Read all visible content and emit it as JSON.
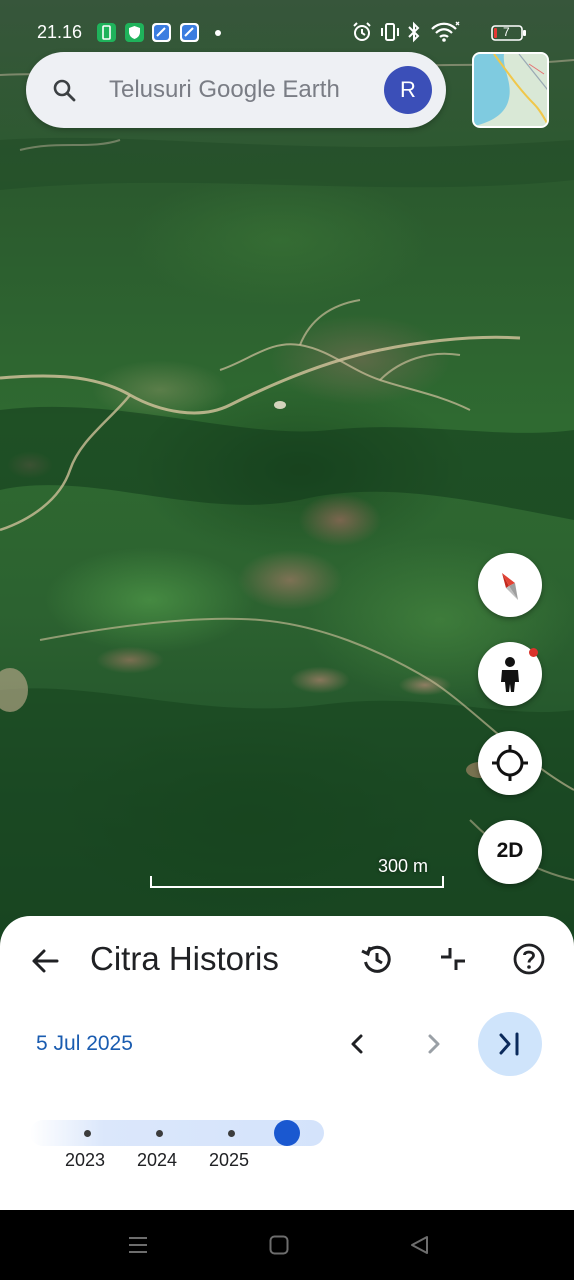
{
  "status_bar": {
    "time": "21.16",
    "icons": [
      "battery-saver-icon",
      "vpn-shield-icon",
      "app-icon",
      "app-icon",
      "alarm-icon",
      "vibrate-icon",
      "bluetooth-icon",
      "wifi-icon"
    ],
    "battery_level": "7"
  },
  "search": {
    "placeholder": "Telusuri Google Earth",
    "avatar_letter": "R"
  },
  "map": {
    "scale_label": "300 m"
  },
  "controls": {
    "view_mode_label": "2D"
  },
  "historical_imagery": {
    "title": "Citra Historis",
    "date": "5 Jul 2025",
    "years": [
      "2023",
      "2024",
      "2025"
    ]
  },
  "colors": {
    "accent_blue": "#1a5cb0",
    "avatar": "#3b4fb8",
    "knob": "#1a58d0",
    "last_button_bg": "#cfe4fb"
  }
}
